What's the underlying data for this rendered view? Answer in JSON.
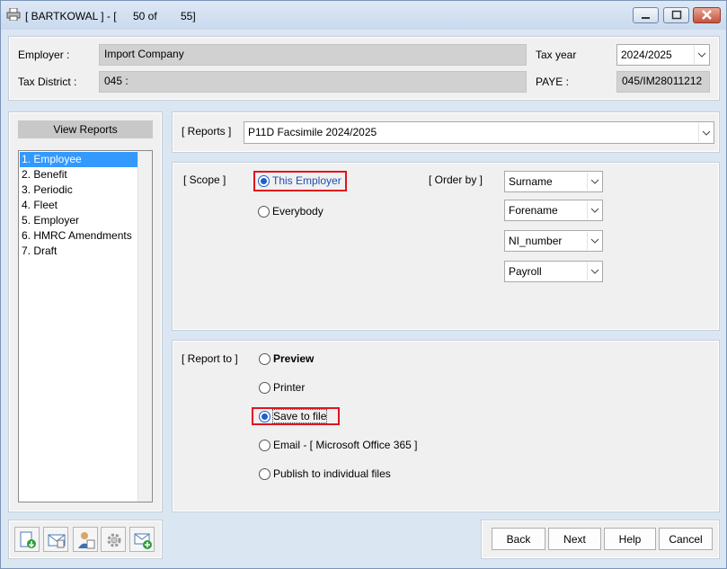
{
  "window": {
    "title": "[ BARTKOWAL ] - [",
    "record_count": "50 of",
    "record_total": "55]"
  },
  "header": {
    "employer_label": "Employer :",
    "employer_value": "Import Company",
    "tax_district_label": "Tax District :",
    "tax_district_value": "045 :",
    "tax_year_label": "Tax year",
    "tax_year_value": "2024/2025",
    "paye_label": "PAYE :",
    "paye_value": "045/IM28011212"
  },
  "sidebar": {
    "header": "View Reports",
    "items": [
      {
        "label": "1. Employee",
        "selected": true
      },
      {
        "label": "2. Benefit"
      },
      {
        "label": "3. Periodic"
      },
      {
        "label": "4. Fleet"
      },
      {
        "label": "5. Employer"
      },
      {
        "label": "6. HMRC Amendments"
      },
      {
        "label": "7. Draft"
      }
    ]
  },
  "reports": {
    "label": "[ Reports ]",
    "value": "P11D Facsimile 2024/2025"
  },
  "scope": {
    "label": "[ Scope ]",
    "options": [
      {
        "label": "This Employer",
        "checked": true
      },
      {
        "label": "Everybody",
        "checked": false
      }
    ]
  },
  "order_by": {
    "label": "[ Order by ]",
    "fields": [
      "Surname",
      "Forename",
      "NI_number",
      "Payroll"
    ]
  },
  "report_to": {
    "label": "[ Report to ]",
    "options": [
      {
        "label": "Preview",
        "checked": false
      },
      {
        "label": "Printer",
        "checked": false
      },
      {
        "label": "Save to file",
        "checked": true
      },
      {
        "label": "Email - [ Microsoft Office 365 ]",
        "checked": false
      },
      {
        "label": "Publish to individual files",
        "checked": false
      }
    ]
  },
  "buttons": {
    "back": "Back",
    "next": "Next",
    "help": "Help",
    "cancel": "Cancel"
  },
  "toolbar_icons": [
    "import-icon",
    "mail-document-icon",
    "user-certificate-icon",
    "gear-icon",
    "mail-add-icon"
  ],
  "colors": {
    "selection": "#3399ff",
    "highlight_border": "#e0141e",
    "radio_checked": "#1f5fc9"
  }
}
